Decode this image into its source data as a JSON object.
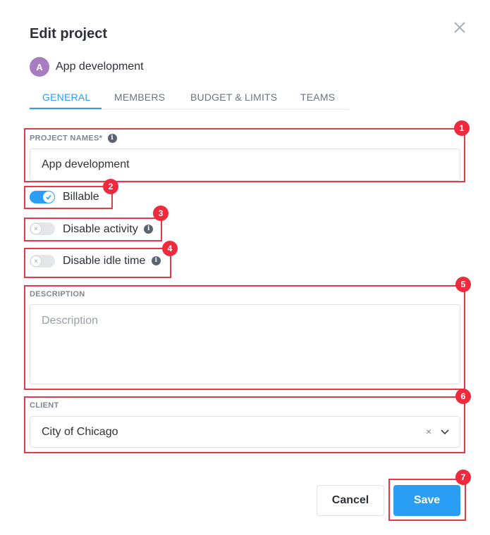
{
  "modal": {
    "title": "Edit project",
    "close_icon": "close-icon"
  },
  "project": {
    "avatar_letter": "A",
    "name": "App development"
  },
  "tabs": [
    {
      "label": "GENERAL",
      "active": true
    },
    {
      "label": "MEMBERS",
      "active": false
    },
    {
      "label": "BUDGET & LIMITS",
      "active": false
    },
    {
      "label": "TEAMS",
      "active": false
    }
  ],
  "form": {
    "project_names_label": "PROJECT NAMES*",
    "project_names_value": "App development",
    "billable": {
      "label": "Billable",
      "on": true
    },
    "disable_activity": {
      "label": "Disable activity",
      "on": false
    },
    "disable_idle_time": {
      "label": "Disable idle time",
      "on": false
    },
    "description_label": "DESCRIPTION",
    "description_placeholder": "Description",
    "client_label": "CLIENT",
    "client_value": "City of Chicago",
    "client_clear": "×"
  },
  "buttons": {
    "cancel": "Cancel",
    "save": "Save"
  },
  "annotations": [
    "1",
    "2",
    "3",
    "4",
    "5",
    "6",
    "7"
  ],
  "colors": {
    "accent": "#2a9df4",
    "highlight": "#e33a48",
    "avatar": "#a87cc1"
  }
}
